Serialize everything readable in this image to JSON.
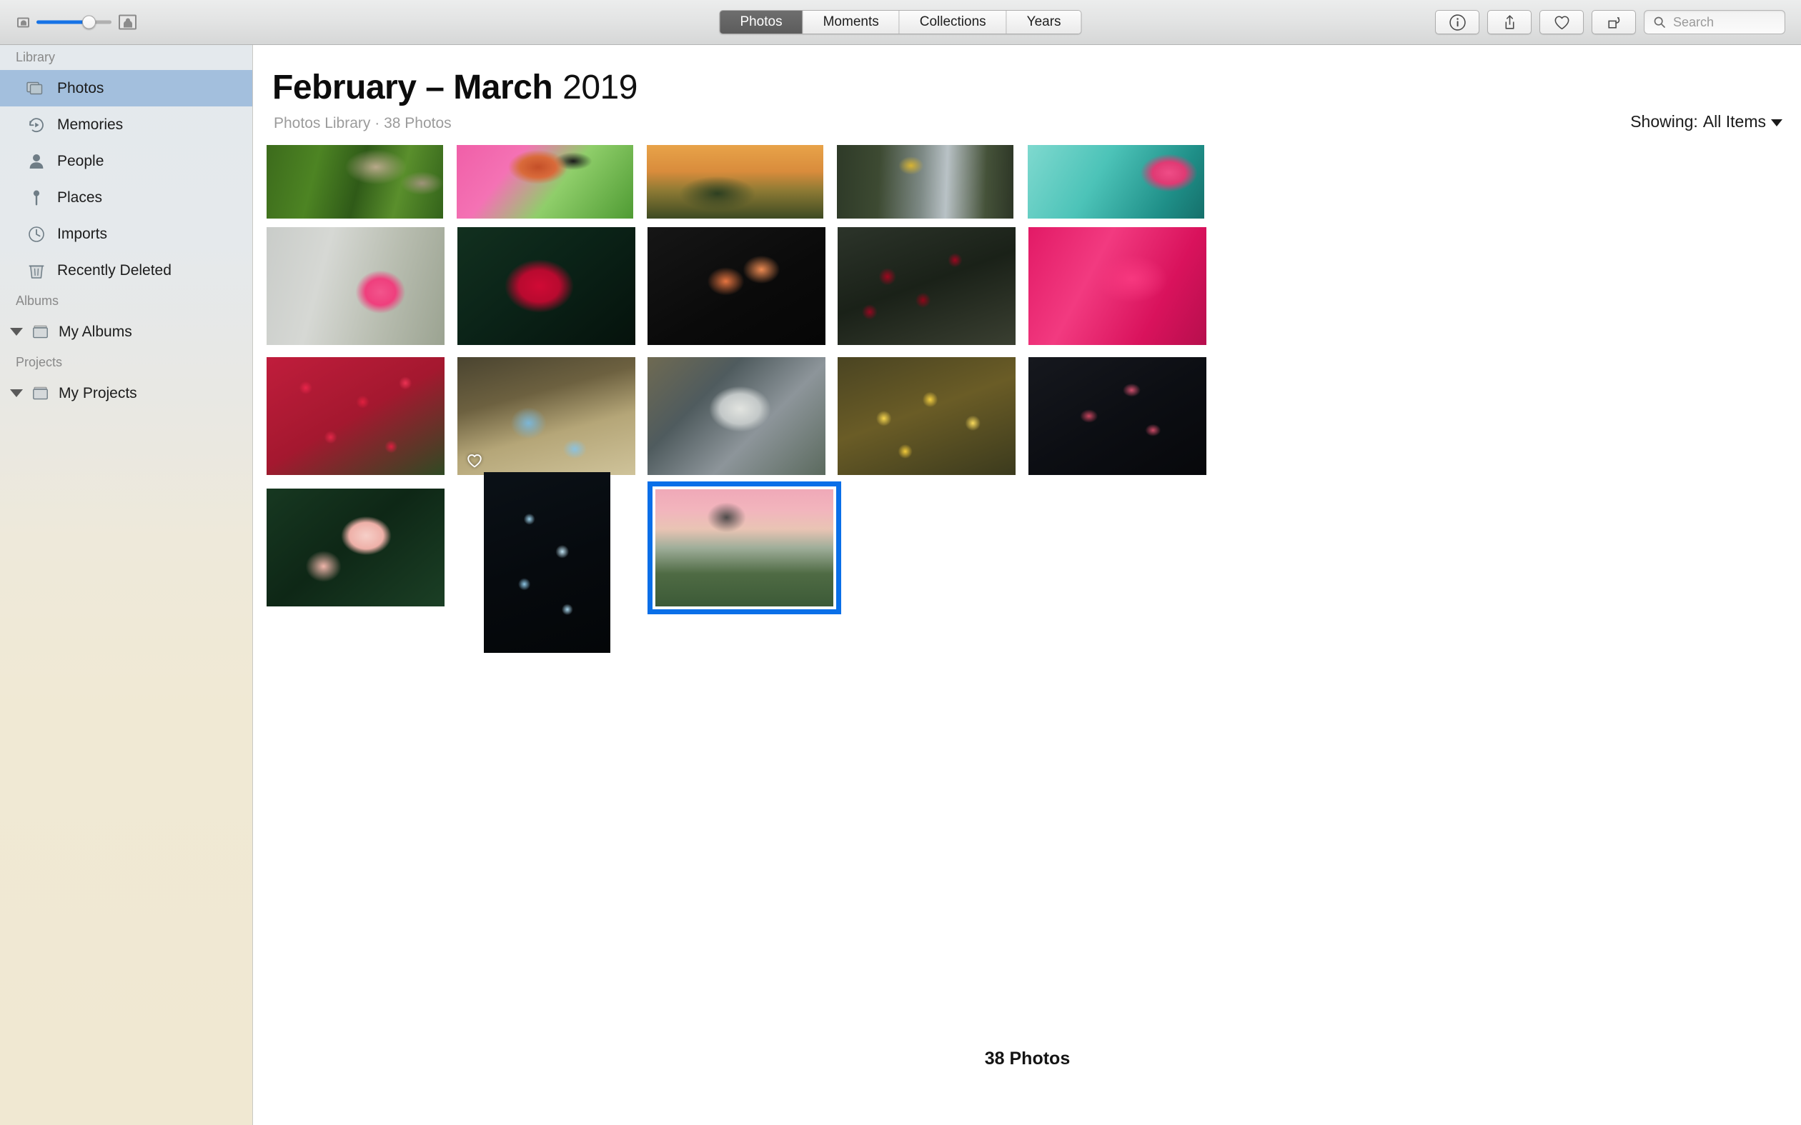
{
  "toolbar": {
    "zoom_slider": {
      "small_icon": "small-thumbnail-icon",
      "large_icon": "large-thumbnail-icon",
      "value_percent": 61
    },
    "tabs": [
      {
        "label": "Photos",
        "active": true
      },
      {
        "label": "Moments",
        "active": false
      },
      {
        "label": "Collections",
        "active": false
      },
      {
        "label": "Years",
        "active": false
      }
    ],
    "buttons": [
      {
        "name": "info-button",
        "icon": "info-circle-icon"
      },
      {
        "name": "share-button",
        "icon": "share-box-arrow-up-icon"
      },
      {
        "name": "favorite-button",
        "icon": "heart-icon"
      },
      {
        "name": "rotate-button",
        "icon": "rotate-counterclockwise-icon"
      }
    ],
    "search": {
      "placeholder": "Search",
      "value": "",
      "icon": "search-magnifier-icon"
    }
  },
  "sidebar": {
    "sections": [
      {
        "title": "Library",
        "items": [
          {
            "label": "Photos",
            "icon": "photos-stack-icon",
            "selected": true
          },
          {
            "label": "Memories",
            "icon": "memories-clock-play-icon",
            "selected": false
          },
          {
            "label": "People",
            "icon": "person-icon",
            "selected": false
          },
          {
            "label": "Places",
            "icon": "map-pin-icon",
            "selected": false
          },
          {
            "label": "Imports",
            "icon": "clock-icon",
            "selected": false
          },
          {
            "label": "Recently Deleted",
            "icon": "trash-icon",
            "selected": false
          }
        ]
      },
      {
        "title": "Albums",
        "items": [
          {
            "label": "My Albums",
            "icon": "album-folder-icon",
            "disclosure": "expanded"
          }
        ]
      },
      {
        "title": "Projects",
        "items": [
          {
            "label": "My Projects",
            "icon": "album-folder-icon",
            "disclosure": "expanded"
          }
        ]
      }
    ]
  },
  "header": {
    "title_main": "February – March",
    "title_year": "2019",
    "subtitle": "Photos Library · 38 Photos",
    "showing_label": "Showing:",
    "showing_value": "All Items"
  },
  "footer": {
    "count_label": "38 Photos"
  },
  "colors": {
    "selection_blue": "#0a6fe8",
    "sidebar_highlight": "#a3bfdd",
    "slider_fill": "#1673e6",
    "active_tab": "#5c5c5c"
  },
  "photo_grid": {
    "total_photos": 38,
    "rows": [
      {
        "row": 1,
        "clipped_top": true,
        "items": [
          {
            "name": "photo-bird-on-branch-green",
            "alt": "Bird perched on mossy branch in green grass"
          },
          {
            "name": "photo-bullfinch-pink-background",
            "alt": "Orange-breasted bird on branch with pink background"
          },
          {
            "name": "photo-golden-sunset-landscape",
            "alt": "Golden sunset over rocky hillside"
          },
          {
            "name": "photo-yellow-bird-bamboo",
            "alt": "Yellow bird perched on bamboo stalks"
          },
          {
            "name": "photo-pink-flowers-teal",
            "alt": "Pink euphorbia flowers on teal background"
          }
        ]
      },
      {
        "row": 2,
        "items": [
          {
            "name": "photo-pink-crown-of-thorns",
            "alt": "Pink crown-of-thorns flowers against gray backdrop"
          },
          {
            "name": "photo-crimson-bougainvillea",
            "alt": "Crimson bougainvillea blooms on dark foliage"
          },
          {
            "name": "photo-orange-marigolds-black",
            "alt": "Orange marigold blossoms on black background"
          },
          {
            "name": "photo-dark-red-roses",
            "alt": "Deep red roses among muted green leaves"
          },
          {
            "name": "photo-magenta-petal-macro",
            "alt": "Macro close-up of magenta ruffled petals"
          }
        ]
      },
      {
        "row": 3,
        "items": [
          {
            "name": "photo-red-tulip-field",
            "alt": "Field of red and white tulips"
          },
          {
            "name": "photo-blue-thistle-wildflowers",
            "alt": "Blue thistle wildflowers in golden meadow",
            "favorite": true
          },
          {
            "name": "photo-white-hellebore",
            "alt": "Pale white hellebore flowers"
          },
          {
            "name": "photo-yellow-daffodils",
            "alt": "Yellow daffodils in a field"
          },
          {
            "name": "photo-pink-succulent-blooms",
            "alt": "Pink succulent flowers on dark background"
          }
        ]
      },
      {
        "row": 4,
        "items": [
          {
            "name": "photo-pink-peonies",
            "alt": "Two pink peonies on dark green foliage"
          },
          {
            "name": "photo-blue-nigella-night",
            "alt": "Blue nigella love-in-a-mist flowers on black"
          },
          {
            "name": "photo-kirkjufell-waterfall",
            "alt": "Kirkjufell mountain with waterfall at pink sunset",
            "selected": true
          }
        ]
      }
    ]
  }
}
